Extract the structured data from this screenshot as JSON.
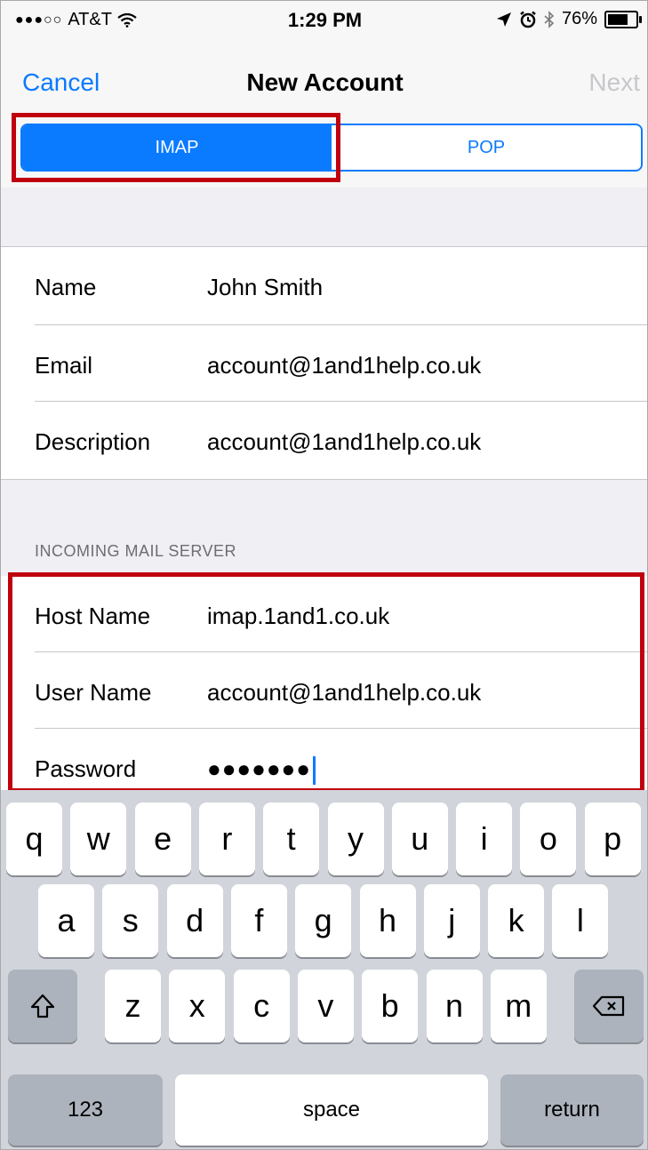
{
  "status_bar": {
    "carrier": "AT&T",
    "signal_dots": "●●●○○",
    "time": "1:29 PM",
    "battery": "76%"
  },
  "nav": {
    "cancel": "Cancel",
    "title": "New Account",
    "next": "Next"
  },
  "segment": {
    "imap": "IMAP",
    "pop": "POP"
  },
  "account": {
    "name_label": "Name",
    "name_value": "John Smith",
    "email_label": "Email",
    "email_value": "account@1and1help.co.uk",
    "description_label": "Description",
    "description_value": "account@1and1help.co.uk"
  },
  "incoming": {
    "header": "INCOMING MAIL SERVER",
    "host_label": "Host Name",
    "host_value": "imap.1and1.co.uk",
    "user_label": "User Name",
    "user_value": "account@1and1help.co.uk",
    "password_label": "Password",
    "password_value": "●●●●●●●"
  },
  "keyboard": {
    "row1": [
      "q",
      "w",
      "e",
      "r",
      "t",
      "y",
      "u",
      "i",
      "o",
      "p"
    ],
    "row2": [
      "a",
      "s",
      "d",
      "f",
      "g",
      "h",
      "j",
      "k",
      "l"
    ],
    "row3": [
      "z",
      "x",
      "c",
      "v",
      "b",
      "n",
      "m"
    ],
    "numbers": "123",
    "space": "space",
    "return": "return"
  },
  "colors": {
    "accent": "#0a7aff",
    "highlight": "#c0000e"
  }
}
